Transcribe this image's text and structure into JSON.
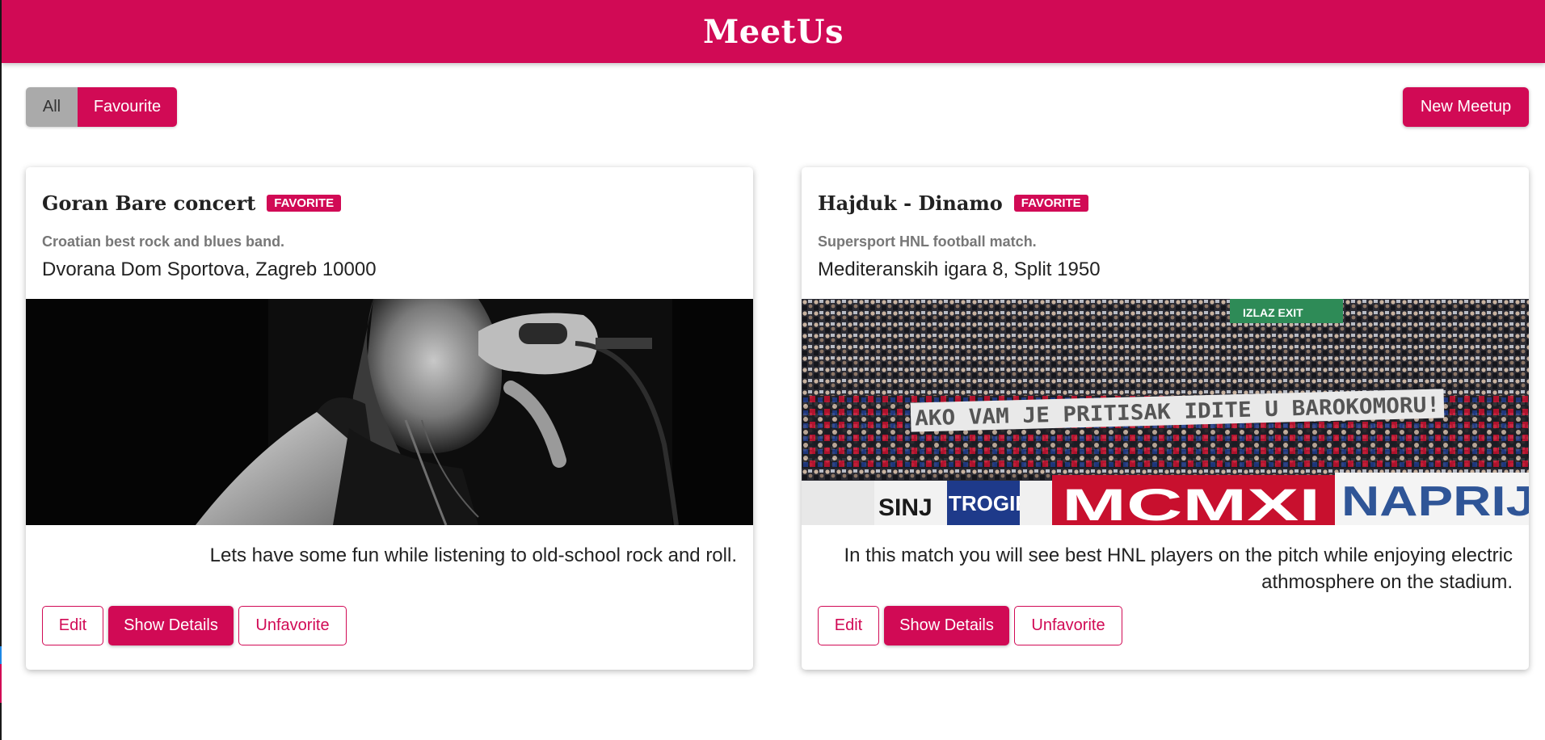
{
  "app": {
    "title": "MeetUs",
    "brand_color": "#d10a55"
  },
  "filters": {
    "all_label": "All",
    "favourite_label": "Favourite",
    "active": "Favourite"
  },
  "toolbar": {
    "new_meetup_label": "New Meetup"
  },
  "meetups": [
    {
      "title": "Goran Bare concert",
      "badge": "FAVORITE",
      "subtitle": "Croatian best rock and blues band.",
      "address": "Dvorana Dom Sportova, Zagreb 10000",
      "image": "black-and-white photo of a singer at a microphone",
      "description": "Lets have some fun while listening to old-school rock and roll.",
      "actions": {
        "edit": "Edit",
        "details": "Show Details",
        "unfavorite": "Unfavorite"
      }
    },
    {
      "title": "Hajduk - Dinamo",
      "badge": "FAVORITE",
      "subtitle": "Supersport HNL football match.",
      "address": "Mediteranskih igara 8, Split 1950",
      "image": "stadium crowd with banners",
      "image_text": {
        "exit_sign": "IZLAZ EXIT",
        "banner": "AKO VAM JE PRITISAK IDITE U BAROKOMORU!",
        "flag_1": "SINJ",
        "flag_2": "TROGIR",
        "flag_3": "MCMXI",
        "flag_4": "NAPRIJ"
      },
      "description": "In this match you will see best HNL players on the pitch while enjoying electric athmosphere on the stadium.",
      "actions": {
        "edit": "Edit",
        "details": "Show Details",
        "unfavorite": "Unfavorite"
      }
    }
  ]
}
